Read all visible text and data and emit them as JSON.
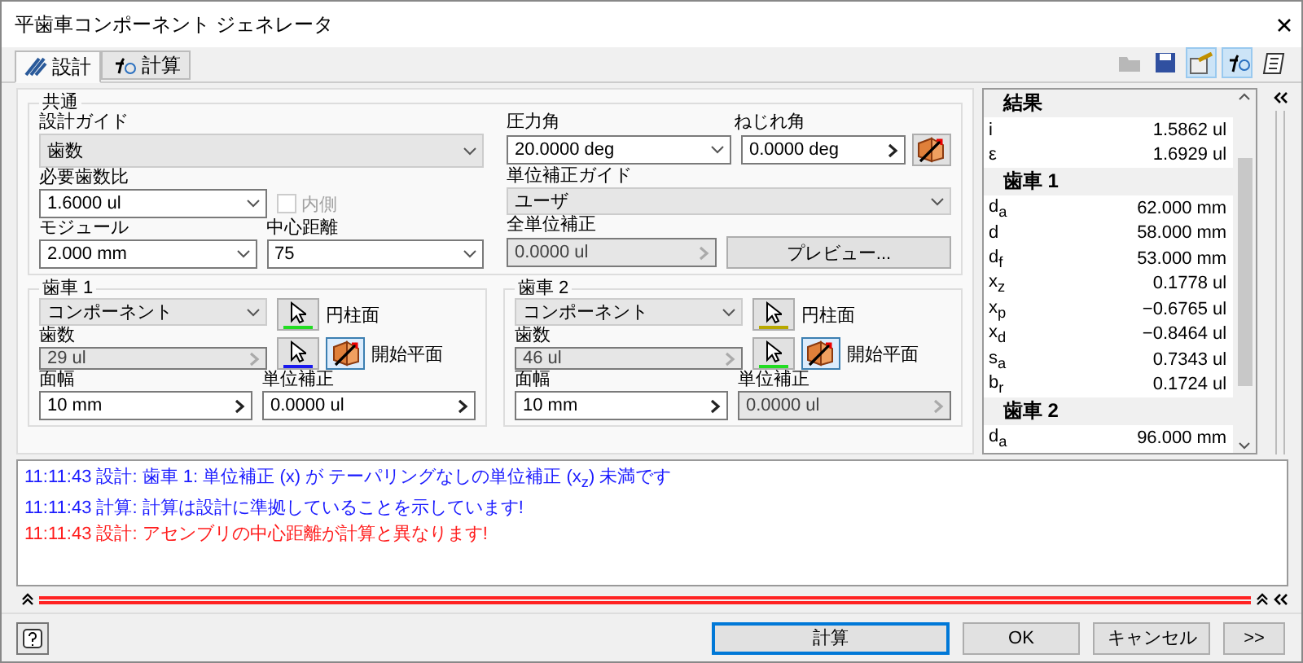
{
  "window": {
    "title": "平歯車コンポーネント ジェネレータ"
  },
  "tabs": [
    {
      "label": "設計",
      "selected": true
    },
    {
      "label": "計算",
      "selected": false
    }
  ],
  "common": {
    "title": "共通",
    "design_guide": {
      "label": "設計ガイド",
      "value": "歯数",
      "kind": "dropdown"
    },
    "ratio": {
      "label": "必要歯数比",
      "value": "1.6000 ul",
      "kind": "combo"
    },
    "internal": {
      "label": "内側",
      "checked": false,
      "disabled": true
    },
    "module": {
      "label": "モジュール",
      "value": "2.000 mm",
      "kind": "combo"
    },
    "center_distance": {
      "label": "中心距離",
      "value": "75",
      "kind": "combo"
    },
    "pressure_angle": {
      "label": "圧力角",
      "value": "20.0000 deg",
      "kind": "combo"
    },
    "helix_angle": {
      "label": "ねじれ角",
      "value": "0.0000 deg",
      "kind": "input",
      "disabled": false
    },
    "unit_correction_guide": {
      "label": "単位補正ガイド",
      "value": "ユーザ",
      "kind": "dropdown"
    },
    "total_correction": {
      "label": "全単位補正",
      "value": "0.0000 ul",
      "kind": "input",
      "disabled": true
    },
    "preview_button": "プレビュー..."
  },
  "gears": [
    {
      "title": "歯車 1",
      "type": {
        "value": "コンポーネント",
        "kind": "dropdown"
      },
      "cylinder": {
        "label": "円柱面",
        "color": "#22dd22"
      },
      "start_plane": {
        "label": "開始平面",
        "color": "#1a1aee"
      },
      "teeth": {
        "label": "歯数",
        "value": "29 ul",
        "kind": "input",
        "disabled": true
      },
      "face_width": {
        "label": "面幅",
        "value": "10 mm",
        "kind": "input",
        "disabled": false
      },
      "correction": {
        "label": "単位補正",
        "value": "0.0000 ul",
        "kind": "input",
        "disabled": false
      }
    },
    {
      "title": "歯車 2",
      "type": {
        "value": "コンポーネント",
        "kind": "dropdown"
      },
      "cylinder": {
        "label": "円柱面",
        "color": "#b8a800"
      },
      "start_plane": {
        "label": "開始平面",
        "color": "#22dd22"
      },
      "teeth": {
        "label": "歯数",
        "value": "46 ul",
        "kind": "input",
        "disabled": true
      },
      "face_width": {
        "label": "面幅",
        "value": "10 mm",
        "kind": "input",
        "disabled": false
      },
      "correction": {
        "label": "単位補正",
        "value": "0.0000 ul",
        "kind": "input",
        "disabled": true
      }
    }
  ],
  "results": {
    "title": "結果",
    "rows": [
      {
        "kind": "value",
        "name": "i",
        "value": "1.5862 ul"
      },
      {
        "kind": "value",
        "name": "ε",
        "value": "1.6929 ul"
      },
      {
        "kind": "header",
        "name": "歯車 1"
      },
      {
        "kind": "value",
        "name": "d$_{a}$",
        "value": "62.000 mm"
      },
      {
        "kind": "value",
        "name": "d",
        "value": "58.000 mm"
      },
      {
        "kind": "value",
        "name": "d$_{f}$",
        "value": "53.000 mm"
      },
      {
        "kind": "value",
        "name": "x$_{z}$",
        "value": "0.1778 ul"
      },
      {
        "kind": "value",
        "name": "x$_{p}$",
        "value": "−0.6765 ul"
      },
      {
        "kind": "value",
        "name": "x$_{d}$",
        "value": "−0.8464 ul"
      },
      {
        "kind": "value",
        "name": "s$_{a}$",
        "value": "0.7343 ul"
      },
      {
        "kind": "value",
        "name": "b$_{r}$",
        "value": "0.1724 ul"
      },
      {
        "kind": "header",
        "name": "歯車 2"
      },
      {
        "kind": "value",
        "name": "d$_{a}$",
        "value": "96.000 mm"
      }
    ]
  },
  "messages": [
    {
      "text": "11:11:43 設計: 歯車 1: 単位補正 (x) が テーパリングなしの単位補正 (x$_{z}$) 未満です",
      "color": "#1a1aff"
    },
    {
      "text": "11:11:43 計算: 計算は設計に準拠していることを示しています!",
      "color": "#1a1aff"
    },
    {
      "text": "11:11:43 設計: アセンブリの中心距離が計算と異なります!",
      "color": "#ff1a1a"
    }
  ],
  "buttons": [
    {
      "label": "計算",
      "default": true
    },
    {
      "label": "OK",
      "default": false
    },
    {
      "label": "キャンセル",
      "default": false
    },
    {
      "label": ">>",
      "default": false
    }
  ]
}
